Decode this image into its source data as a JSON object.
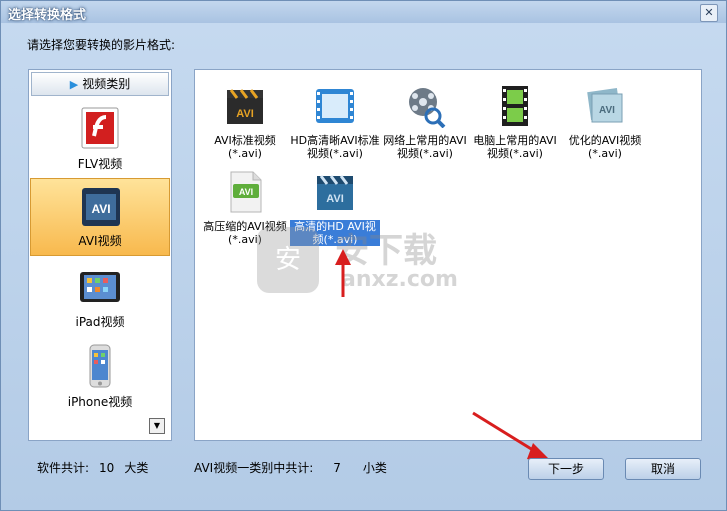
{
  "window": {
    "title": "选择转换格式",
    "close_glyph": "✕"
  },
  "prompt": "请选择您要转换的影片格式:",
  "sidebar": {
    "header": "视频类别",
    "items": [
      {
        "label": "FLV视频",
        "icon": "flv-flash-icon"
      },
      {
        "label": "AVI视频",
        "icon": "avi-film-icon",
        "selected": true
      },
      {
        "label": "iPad视频",
        "icon": "ipad-icon"
      },
      {
        "label": "iPhone视频",
        "icon": "iphone-icon"
      }
    ]
  },
  "formats": [
    {
      "label": "AVI标准视频(*.avi)",
      "icon": "avi-clapper-icon"
    },
    {
      "label": "HD高清晰AVI标准视频(*.avi)",
      "icon": "film-strip-blue-icon"
    },
    {
      "label": "网络上常用的AVI视频(*.avi)",
      "icon": "film-reel-magnifier-icon"
    },
    {
      "label": "电脑上常用的AVI视频(*.avi)",
      "icon": "film-strip-green-icon"
    },
    {
      "label": "优化的AVI视频(*.avi)",
      "icon": "avi-film-pages-icon"
    },
    {
      "label": "高压缩的AVI视频(*.avi)",
      "icon": "avi-document-icon"
    },
    {
      "label": "高清的HD AVI视频(*.avi)",
      "icon": "avi-clapper-blue-icon",
      "selected": true
    }
  ],
  "watermark": {
    "line1": "安下载",
    "line2": "anxz.com",
    "shield": "安"
  },
  "footer": {
    "software_total_label": "软件共计:",
    "software_total_value": "10",
    "software_total_unit": "大类",
    "category_total_label": "AVI视频一类别中共计:",
    "category_total_value": "7",
    "category_total_unit": "小类"
  },
  "buttons": {
    "next": "下一步",
    "cancel": "取消"
  },
  "colors": {
    "selection_orange": "#f8b94e",
    "selection_blue": "#3a7dd8",
    "arrow_red": "#d81e1e"
  }
}
